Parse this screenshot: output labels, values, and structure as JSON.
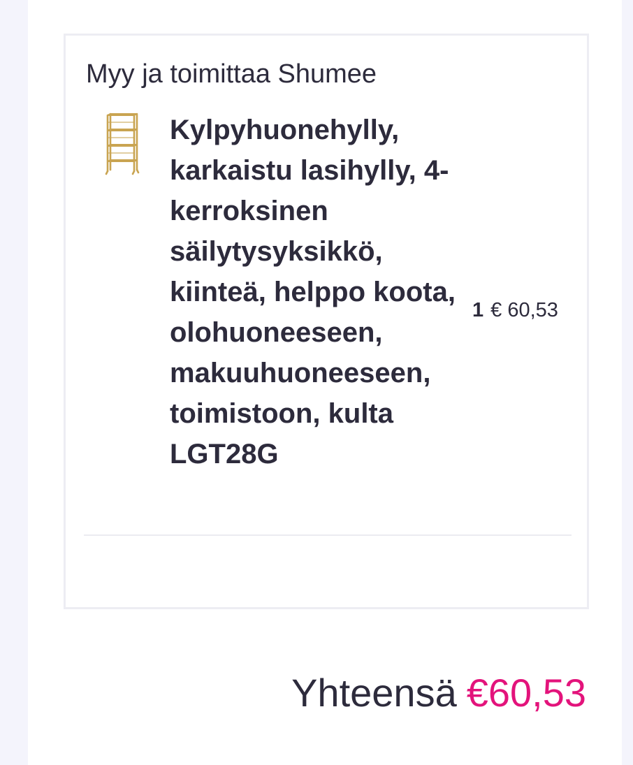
{
  "order": {
    "seller_line": "Myy ja toimittaa Shumee",
    "item": {
      "thumbnail_icon": "gold-glass-shelf-image",
      "title": "Kylpyhuonehylly, karkaistu lasihylly, 4-kerroksinen säilytysyksikkö, kiinteä, helppo koota, olohuoneeseen, makuuhuoneeseen, toimistoon, kulta LGT28G",
      "quantity": "1",
      "price": "€ 60,53"
    }
  },
  "summary": {
    "total_label": "Yhteensä",
    "total_value": "€60,53"
  },
  "colors": {
    "text": "#2d2b3c",
    "accent": "#e3137b",
    "shelf_gold": "#c9a451"
  }
}
